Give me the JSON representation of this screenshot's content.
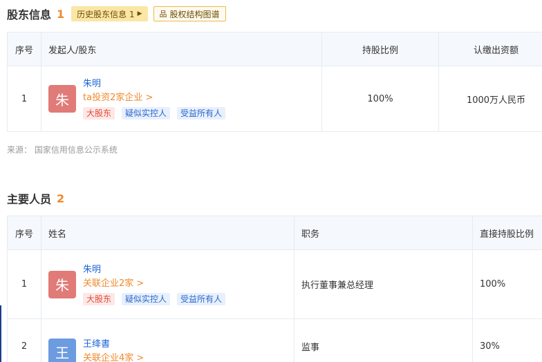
{
  "shareholders": {
    "title": "股东信息",
    "count": "1",
    "history_button": "历史股东信息 1",
    "equity_button": "股权结构图谱",
    "columns": [
      "序号",
      "发起人/股东",
      "持股比例",
      "认缴出资额"
    ],
    "rows": [
      {
        "index": "1",
        "avatar_char": "朱",
        "avatar_color": "#e07b78",
        "name": "朱明",
        "link": "ta投资2家企业 >",
        "tags": [
          "大股东",
          "疑似实控人",
          "受益所有人"
        ],
        "ratio": "100%",
        "capital": "1000万人民币"
      }
    ],
    "source": "来源：  国家信用信息公示系统"
  },
  "personnel": {
    "title": "主要人员",
    "count": "2",
    "columns": [
      "序号",
      "姓名",
      "职务",
      "直接持股比例"
    ],
    "rows": [
      {
        "index": "1",
        "avatar_char": "朱",
        "avatar_color": "#e07b78",
        "name": "朱明",
        "link": "关联企业2家 >",
        "tags": [
          "大股东",
          "疑似实控人",
          "受益所有人"
        ],
        "position": "执行董事兼总经理",
        "ratio": "100%"
      },
      {
        "index": "2",
        "avatar_char": "王",
        "avatar_color": "#6c9be0",
        "name": "王绛書",
        "link": "关联企业4家 >",
        "position": "监事",
        "ratio": "30%"
      }
    ]
  }
}
